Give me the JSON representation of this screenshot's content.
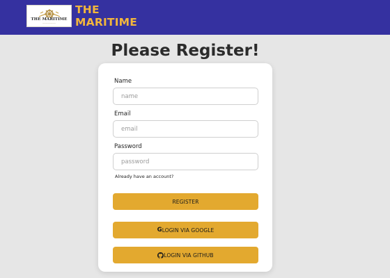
{
  "navbar": {
    "logo_text": "THE MARITIME",
    "brand_line1": "THE",
    "brand_line2": "MARITIME"
  },
  "page": {
    "title": "Please Register!"
  },
  "form": {
    "name_label": "Name",
    "name_placeholder": "name",
    "email_label": "Email",
    "email_placeholder": "email",
    "password_label": "Password",
    "password_placeholder": "password",
    "account_link": "Already have an account?",
    "register_label": "REGISTER",
    "google_icon": "G",
    "google_label": "LOGIN VIA GOOGLE",
    "github_label": "LOGIN VIA GITHUB"
  },
  "icons": {
    "google": "google-icon",
    "github": "github-icon"
  },
  "colors": {
    "navbar": "#3531a0",
    "brand_text": "#f2b63c",
    "button": "#e3a92f",
    "background": "#e6e6e6"
  }
}
